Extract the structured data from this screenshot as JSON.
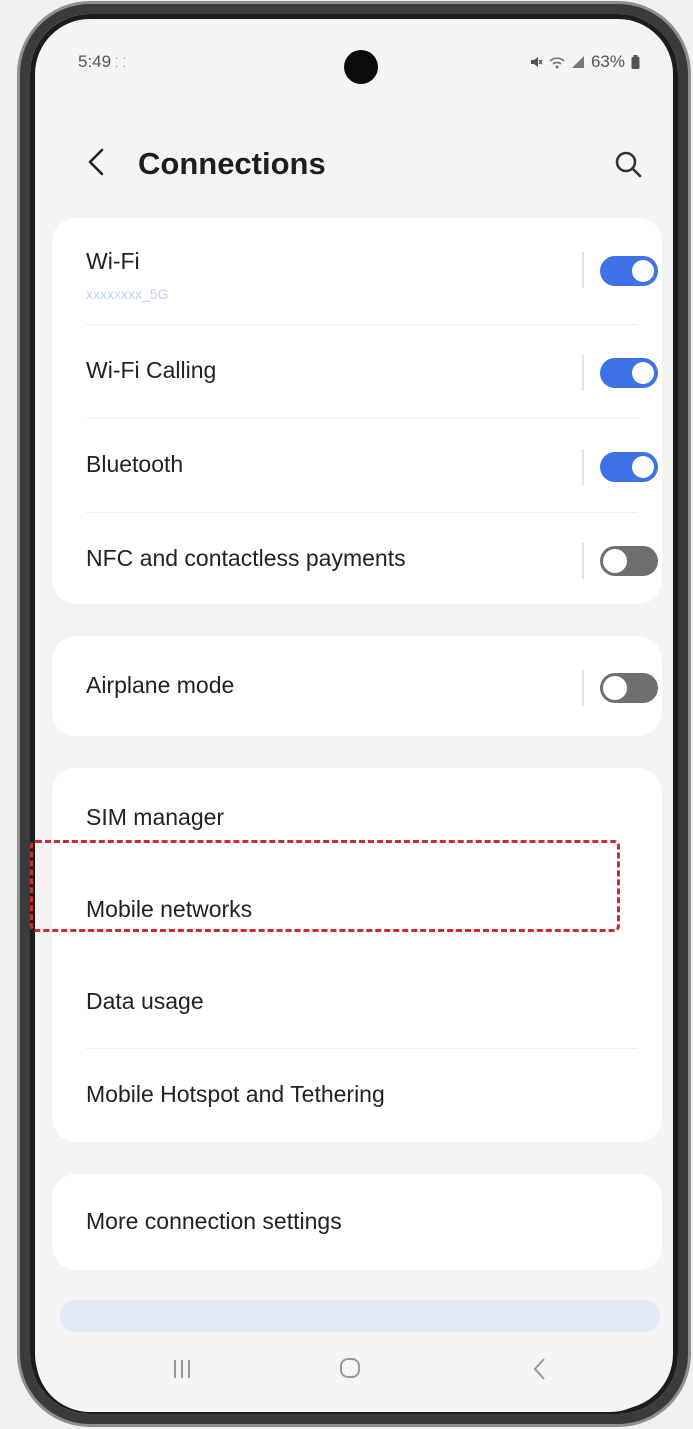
{
  "status_bar": {
    "time": "5:49",
    "time_extra": "⸬",
    "battery": "63%"
  },
  "header": {
    "title": "Connections"
  },
  "group1": {
    "wifi": {
      "label": "Wi-Fi",
      "network": "xxxxxxxx_5G",
      "on": true
    },
    "wifi_calling": {
      "label": "Wi-Fi Calling",
      "on": true
    },
    "bluetooth": {
      "label": "Bluetooth",
      "on": true
    },
    "nfc": {
      "label": "NFC and contactless payments",
      "on": false
    }
  },
  "group2": {
    "airplane": {
      "label": "Airplane mode",
      "on": false
    }
  },
  "group3": {
    "sim_manager": "SIM manager",
    "mobile_networks": "Mobile networks",
    "data_usage": "Data usage",
    "hotspot": "Mobile Hotspot and Tethering"
  },
  "group4": {
    "more": "More connection settings"
  },
  "colors": {
    "accent": "#3e73e8",
    "highlight": "#cc2b35"
  }
}
